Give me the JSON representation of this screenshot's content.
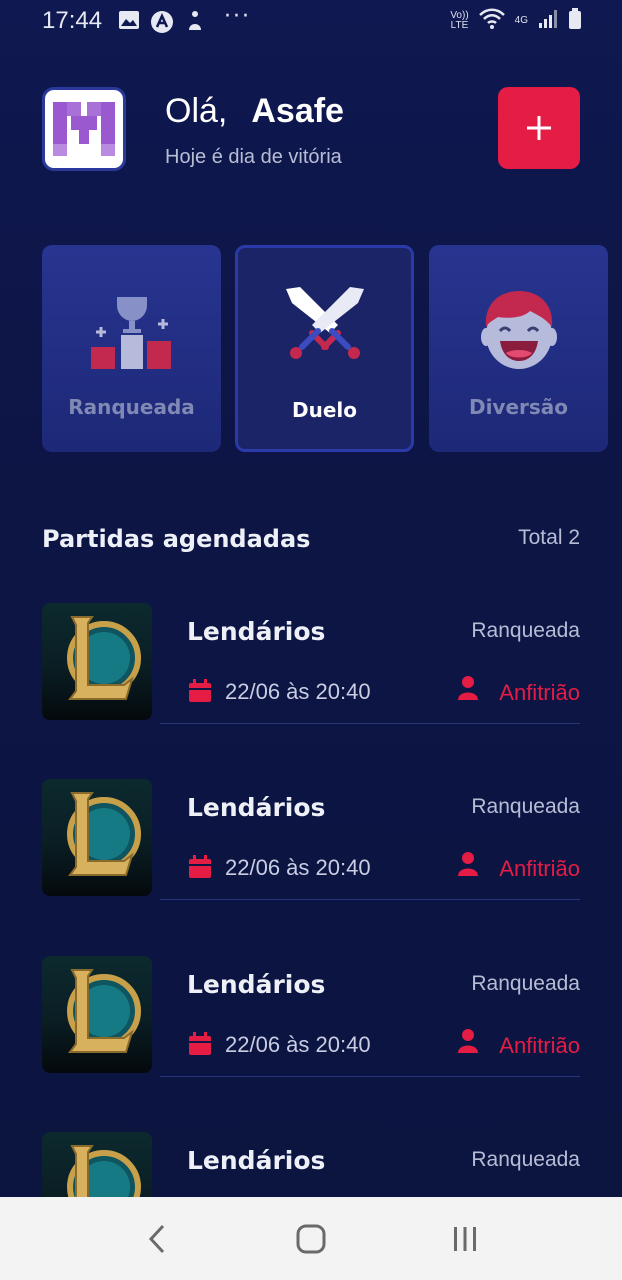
{
  "status_bar": {
    "time": "17:44",
    "volte": "Vo))\nLTE",
    "network": "4G",
    "icons": [
      "image-icon",
      "app-icon",
      "accessibility-icon",
      "more-dots-icon",
      "wifi-icon",
      "signal-icon",
      "battery-icon"
    ]
  },
  "header": {
    "greeting": "Olá,",
    "user_name": "Asafe",
    "subtitle": "Hoje é dia de vitória",
    "add_label": "+"
  },
  "categories": [
    {
      "label": "Ranqueada",
      "icon": "podium-icon",
      "active": false
    },
    {
      "label": "Duelo",
      "icon": "crossed-swords-icon",
      "active": true
    },
    {
      "label": "Diversão",
      "icon": "laughing-face-icon",
      "active": false
    }
  ],
  "section": {
    "title": "Partidas agendadas",
    "total": "Total 2"
  },
  "matches": [
    {
      "title": "Lendários",
      "type": "Ranqueada",
      "date": "22/06 às 20:40",
      "role": "Anfitrião"
    },
    {
      "title": "Lendários",
      "type": "Ranqueada",
      "date": "22/06 às 20:40",
      "role": "Anfitrião"
    },
    {
      "title": "Lendários",
      "type": "Ranqueada",
      "date": "22/06 às 20:40",
      "role": "Anfitrião"
    },
    {
      "title": "Lendários",
      "type": "Ranqueada"
    }
  ],
  "colors": {
    "background": "#0e1647",
    "accent": "#e51c44",
    "card": "#283590",
    "muted_text": "#b8bdd6"
  },
  "nav": {
    "buttons": [
      "back-icon",
      "home-icon",
      "recents-icon"
    ]
  }
}
